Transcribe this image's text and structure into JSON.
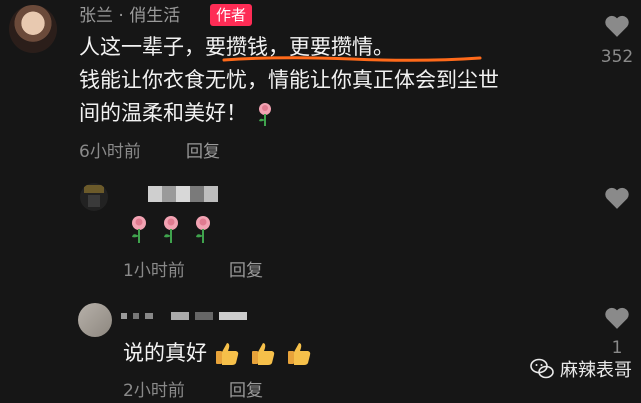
{
  "top_comment": {
    "author": "张兰 · 俏生活",
    "badge": "作者",
    "lines": [
      "人这一辈子，要攒钱，更要攒情。",
      "钱能让你衣食无忧，情能让你真正体会到尘世",
      "间的温柔和美好！"
    ],
    "line1_plain": "人这一辈子，",
    "line1_highlight": "要攒钱，更要攒情。",
    "time": "6小时前",
    "reply_label": "回复",
    "like_count": "352",
    "emoji": "rose"
  },
  "reply_1": {
    "emoji_count": 3,
    "emoji": "rose",
    "time": "1小时前",
    "reply_label": "回复"
  },
  "reply_2": {
    "text": "说的真好",
    "emoji": "thumbs-up",
    "emoji_count": 3,
    "time": "2小时前",
    "reply_label": "回复",
    "like_count": "1"
  },
  "watermark": {
    "text": "麻辣表哥"
  },
  "colors": {
    "background": "#161616",
    "author_badge": "#fe2c55",
    "underline": "#ff6a1a"
  }
}
